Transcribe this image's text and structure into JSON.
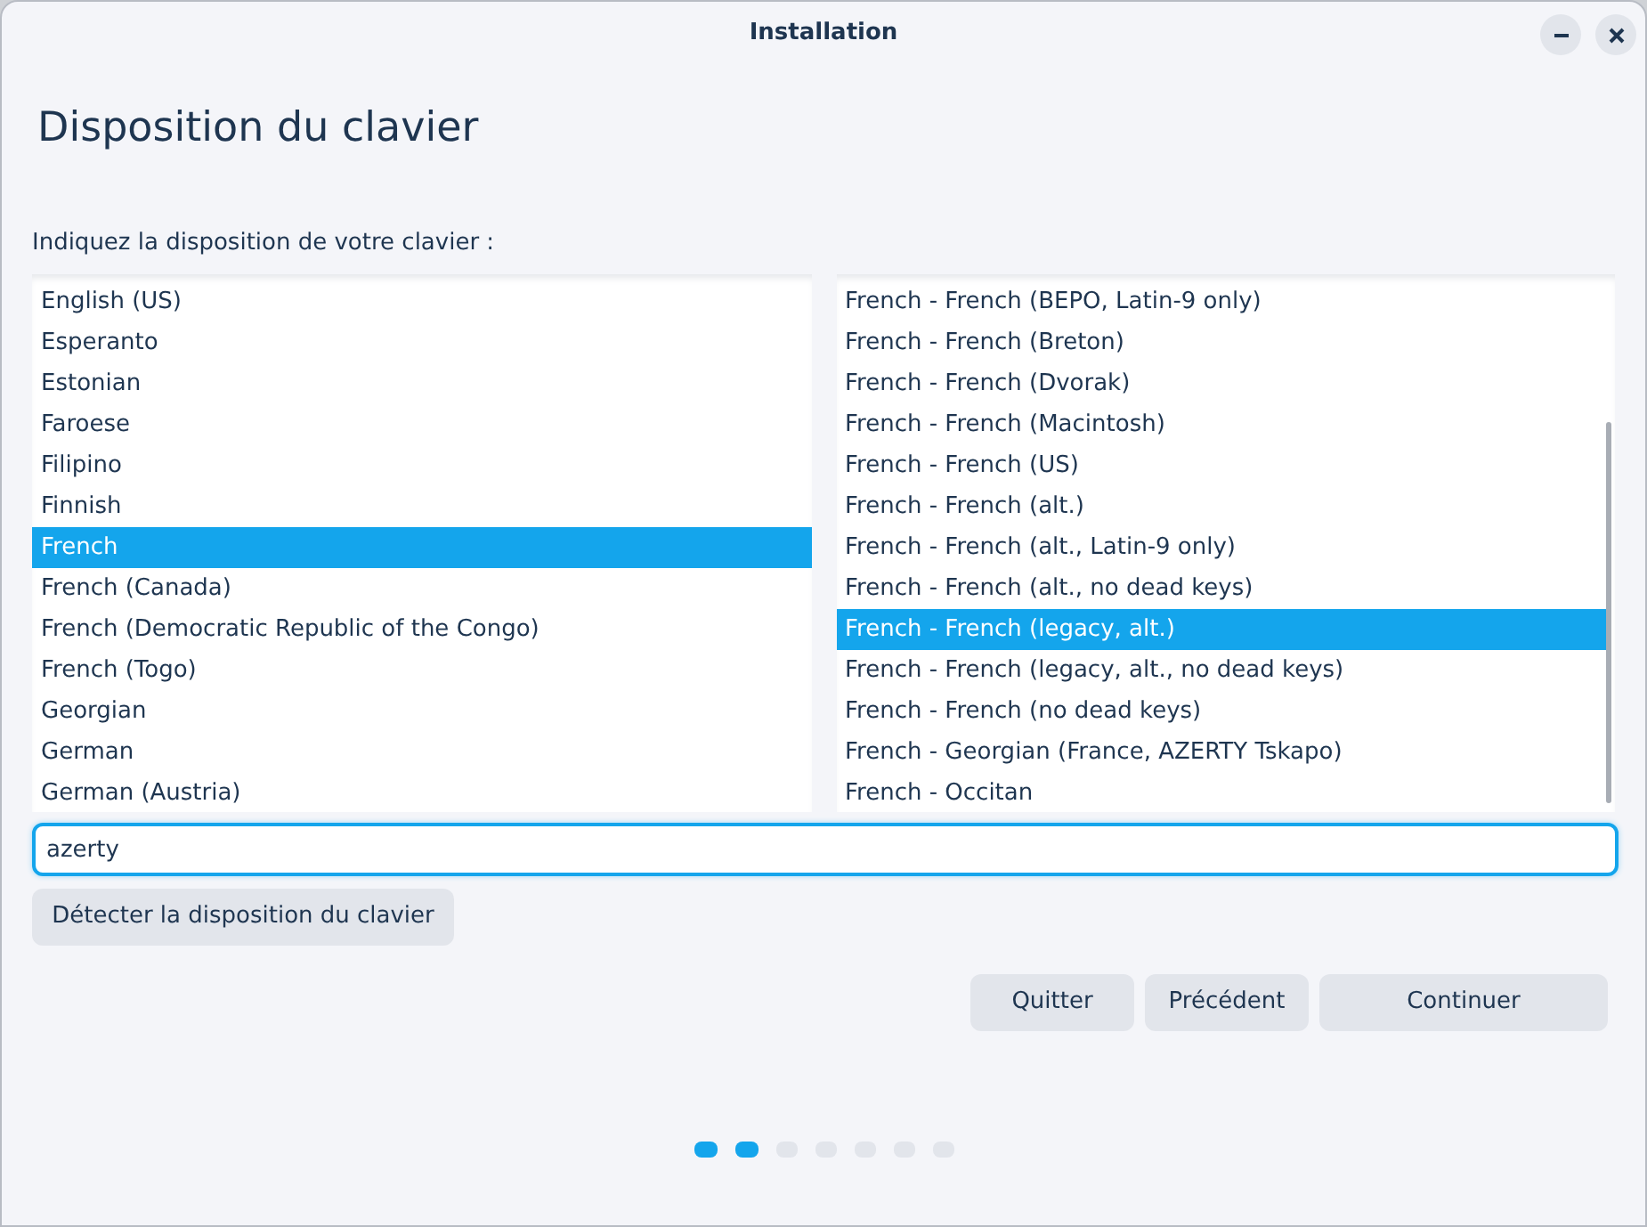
{
  "window": {
    "title": "Installation"
  },
  "heading": "Disposition du clavier",
  "prompt": "Indiquez la disposition de votre clavier :",
  "layouts": [
    {
      "label": "English (US)",
      "selected": false
    },
    {
      "label": "Esperanto",
      "selected": false
    },
    {
      "label": "Estonian",
      "selected": false
    },
    {
      "label": "Faroese",
      "selected": false
    },
    {
      "label": "Filipino",
      "selected": false
    },
    {
      "label": "Finnish",
      "selected": false
    },
    {
      "label": "French",
      "selected": true
    },
    {
      "label": "French (Canada)",
      "selected": false
    },
    {
      "label": "French (Democratic Republic of the Congo)",
      "selected": false
    },
    {
      "label": "French (Togo)",
      "selected": false
    },
    {
      "label": "Georgian",
      "selected": false
    },
    {
      "label": "German",
      "selected": false
    },
    {
      "label": "German (Austria)",
      "selected": false
    }
  ],
  "variants": [
    {
      "label": "French - French (BEPO, Latin-9 only)",
      "selected": false
    },
    {
      "label": "French - French (Breton)",
      "selected": false
    },
    {
      "label": "French - French (Dvorak)",
      "selected": false
    },
    {
      "label": "French - French (Macintosh)",
      "selected": false
    },
    {
      "label": "French - French (US)",
      "selected": false
    },
    {
      "label": "French - French (alt.)",
      "selected": false
    },
    {
      "label": "French - French (alt., Latin-9 only)",
      "selected": false
    },
    {
      "label": "French - French (alt., no dead keys)",
      "selected": false
    },
    {
      "label": "French - French (legacy, alt.)",
      "selected": true
    },
    {
      "label": "French - French (legacy, alt., no dead keys)",
      "selected": false
    },
    {
      "label": "French - French (no dead keys)",
      "selected": false
    },
    {
      "label": "French - Georgian (France, AZERTY Tskapo)",
      "selected": false
    },
    {
      "label": "French - Occitan",
      "selected": false
    }
  ],
  "search": {
    "value": "azerty"
  },
  "detect_button": "Détecter la disposition du clavier",
  "buttons": [
    "Quitter",
    "Précédent",
    "Continuer"
  ],
  "steps": [
    {
      "done": true
    },
    {
      "done": true
    },
    {
      "done": false
    },
    {
      "done": false
    },
    {
      "done": false
    },
    {
      "done": false
    },
    {
      "done": false
    }
  ]
}
